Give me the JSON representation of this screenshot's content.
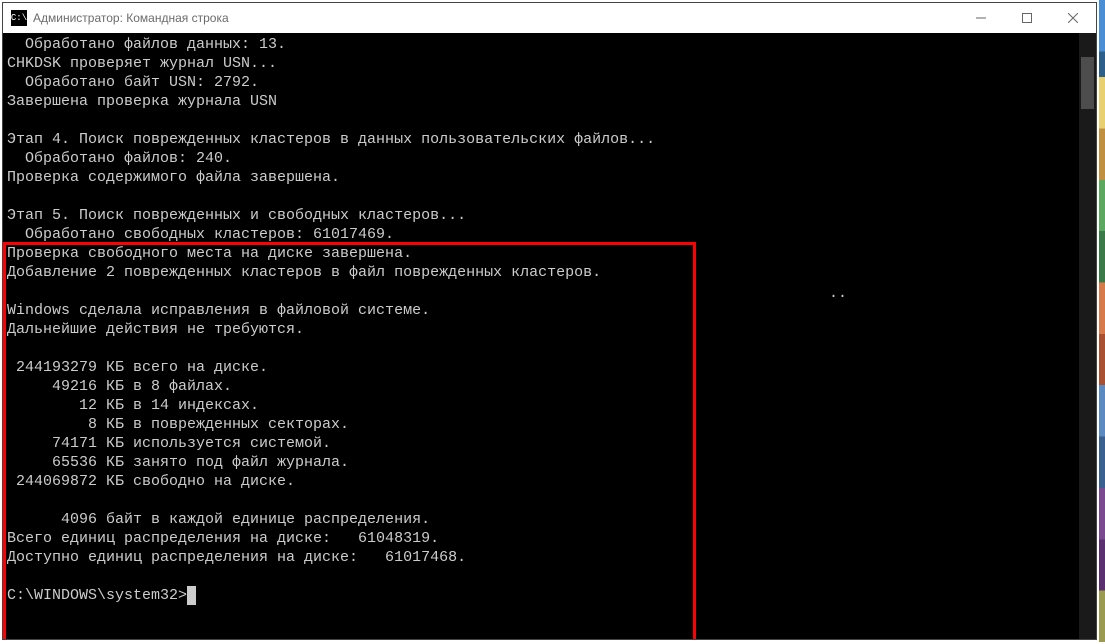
{
  "window": {
    "title": "Администратор: Командная строка"
  },
  "console": {
    "lines": [
      "  Обработано файлов данных: 13.",
      "CHKDSK проверяет журнал USN...",
      "  Обработано байт USN: 2792.",
      "Завершена проверка журнала USN",
      "",
      "Этап 4. Поиск поврежденных кластеров в данных пользовательских файлов...",
      "  Обработано файлов: 240.",
      "Проверка содержимого файла завершена.",
      "",
      "Этап 5. Поиск поврежденных и свободных кластеров...",
      "  Обработано свободных кластеров: 61017469.",
      "Проверка свободного места на диске завершена.",
      "Добавление 2 поврежденных кластеров в файл поврежденных кластеров.",
      "",
      "Windows сделала исправления в файловой системе.",
      "Дальнейшие действия не требуются.",
      "",
      " 244193279 КБ всего на диске.",
      "     49216 КБ в 8 файлах.",
      "        12 КБ в 14 индексах.",
      "         8 КБ в поврежденных секторах.",
      "     74171 КБ используется системой.",
      "     65536 КБ занято под файл журнала.",
      " 244069872 КБ свободно на диске.",
      "",
      "      4096 байт в каждой единице распределения.",
      "Всего единиц распределения на диске:   61048319.",
      "Доступно единиц распределения на диске:   61017468.",
      ""
    ],
    "prompt": "C:\\WINDOWS\\system32>",
    "extra_dots": ".."
  }
}
